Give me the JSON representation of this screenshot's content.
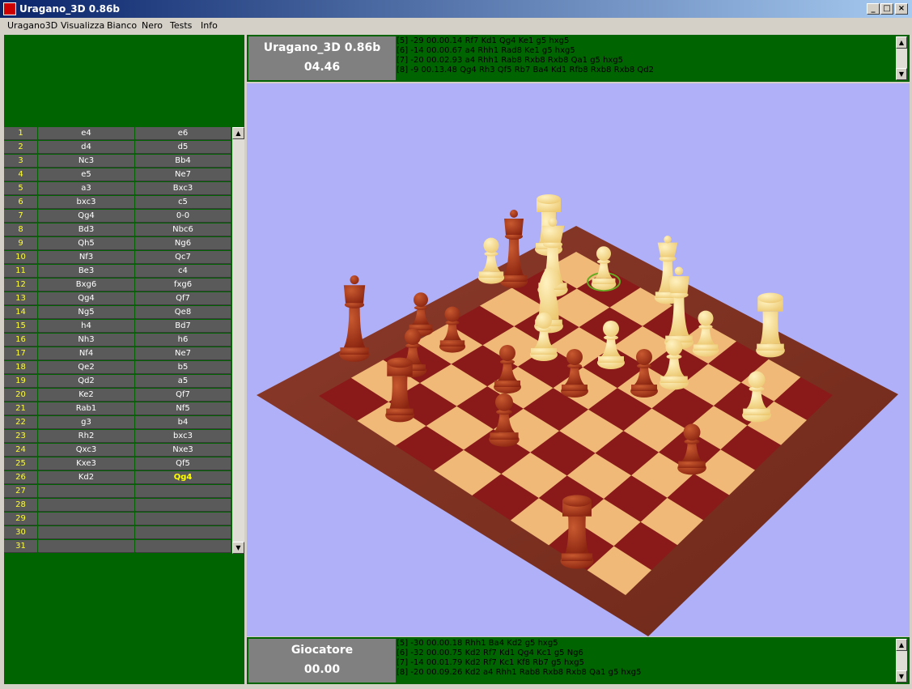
{
  "window": {
    "title": "Uragano_3D 0.86b",
    "controls": {
      "minimize": "_",
      "maximize": "□",
      "close": "×"
    }
  },
  "menu": [
    "Uragano3D",
    "Visualizza",
    "Bianco",
    "Nero",
    "Tests",
    "Info"
  ],
  "moves": [
    {
      "n": "1",
      "w": "e4",
      "b": "e6"
    },
    {
      "n": "2",
      "w": "d4",
      "b": "d5"
    },
    {
      "n": "3",
      "w": "Nc3",
      "b": "Bb4"
    },
    {
      "n": "4",
      "w": "e5",
      "b": "Ne7"
    },
    {
      "n": "5",
      "w": "a3",
      "b": "Bxc3"
    },
    {
      "n": "6",
      "w": "bxc3",
      "b": "c5"
    },
    {
      "n": "7",
      "w": "Qg4",
      "b": "0-0"
    },
    {
      "n": "8",
      "w": "Bd3",
      "b": "Nbc6"
    },
    {
      "n": "9",
      "w": "Qh5",
      "b": "Ng6"
    },
    {
      "n": "10",
      "w": "Nf3",
      "b": "Qc7"
    },
    {
      "n": "11",
      "w": "Be3",
      "b": "c4"
    },
    {
      "n": "12",
      "w": "Bxg6",
      "b": "fxg6"
    },
    {
      "n": "13",
      "w": "Qg4",
      "b": "Qf7"
    },
    {
      "n": "14",
      "w": "Ng5",
      "b": "Qe8"
    },
    {
      "n": "15",
      "w": "h4",
      "b": "Bd7"
    },
    {
      "n": "16",
      "w": "Nh3",
      "b": "h6"
    },
    {
      "n": "17",
      "w": "Nf4",
      "b": "Ne7"
    },
    {
      "n": "18",
      "w": "Qe2",
      "b": "b5"
    },
    {
      "n": "19",
      "w": "Qd2",
      "b": "a5"
    },
    {
      "n": "20",
      "w": "Ke2",
      "b": "Qf7"
    },
    {
      "n": "21",
      "w": "Rab1",
      "b": "Nf5"
    },
    {
      "n": "22",
      "w": "g3",
      "b": "b4"
    },
    {
      "n": "23",
      "w": "Rh2",
      "b": "bxc3"
    },
    {
      "n": "24",
      "w": "Qxc3",
      "b": "Nxe3"
    },
    {
      "n": "25",
      "w": "Kxe3",
      "b": "Qf5"
    },
    {
      "n": "26",
      "w": "Kd2",
      "b": "Qg4"
    },
    {
      "n": "27",
      "w": "",
      "b": ""
    },
    {
      "n": "28",
      "w": "",
      "b": ""
    },
    {
      "n": "29",
      "w": "",
      "b": ""
    },
    {
      "n": "30",
      "w": "",
      "b": ""
    },
    {
      "n": "31",
      "w": "",
      "b": ""
    }
  ],
  "highlight_move": "26b",
  "engine": {
    "name": "Uragano_3D 0.86b",
    "time": "04.46",
    "pv": [
      "[5]  -29 00.00.14 Rf7 Kd1 Qg4 Ke1 g5 hxg5",
      "[6]  -14 00.00.67 a4 Rhh1 Rad8 Ke1 g5 hxg5",
      "[7]  -20 00.02.93 a4 Rhh1 Rab8 Rxb8 Rxb8 Qa1 g5 hxg5",
      "[8]  -9 00.13.48 Qg4 Rh3 Qf5 Rb7 Ba4 Kd1 Rfb8 Rxb8 Rxb8 Qd2"
    ]
  },
  "player": {
    "name": "Giocatore",
    "time": "00.00",
    "pv": [
      "[5]  -30 00.00.18 Rhh1 Ba4 Kd2 g5 hxg5",
      "[6]  -32 00.00.75 Kd2 Rf7 Kd1 Qg4 Kc1 g5 Ng6",
      "[7]  -14 00.01.79 Kd2 Rf7 Kc1 Kf8 Rb7 g5 hxg5",
      "[8]  -20 00.09.26 Kd2 a4 Rhh1 Rab8 Rxb8 Rxb8 Qa1 g5 hxg5"
    ]
  },
  "scroll": {
    "up": "▲",
    "down": "▼"
  },
  "colors": {
    "panel_green": "#006400",
    "board_light": "#f0b978",
    "board_dark": "#8a1a1a",
    "board_frame": "#8c3a2a",
    "white_piece": "#ecc870",
    "black_piece": "#8a2410",
    "viewport_bg": "#b0b0f8",
    "selection_ring": "#66aa22"
  }
}
